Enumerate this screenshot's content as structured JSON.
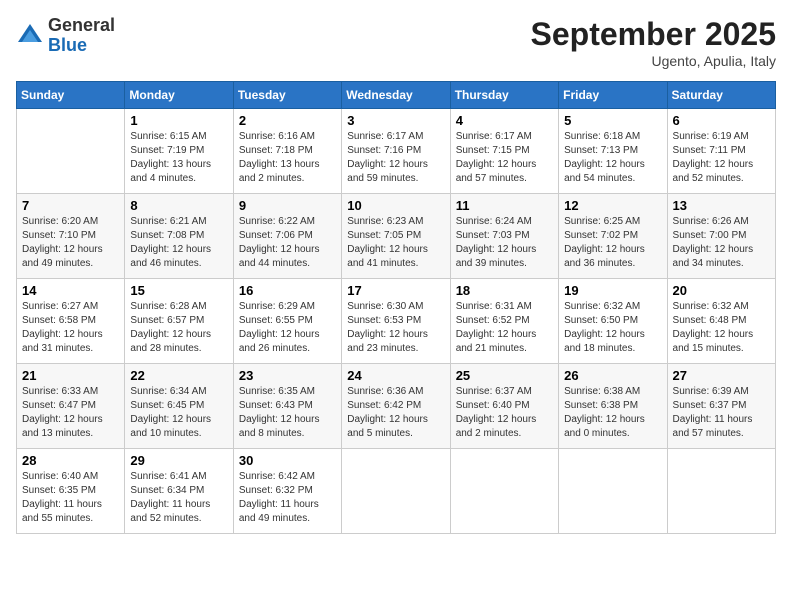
{
  "header": {
    "logo_general": "General",
    "logo_blue": "Blue",
    "month_title": "September 2025",
    "location": "Ugento, Apulia, Italy"
  },
  "days_of_week": [
    "Sunday",
    "Monday",
    "Tuesday",
    "Wednesday",
    "Thursday",
    "Friday",
    "Saturday"
  ],
  "weeks": [
    [
      {
        "day": "",
        "sunrise": "",
        "sunset": "",
        "daylight": ""
      },
      {
        "day": "1",
        "sunrise": "Sunrise: 6:15 AM",
        "sunset": "Sunset: 7:19 PM",
        "daylight": "Daylight: 13 hours and 4 minutes."
      },
      {
        "day": "2",
        "sunrise": "Sunrise: 6:16 AM",
        "sunset": "Sunset: 7:18 PM",
        "daylight": "Daylight: 13 hours and 2 minutes."
      },
      {
        "day": "3",
        "sunrise": "Sunrise: 6:17 AM",
        "sunset": "Sunset: 7:16 PM",
        "daylight": "Daylight: 12 hours and 59 minutes."
      },
      {
        "day": "4",
        "sunrise": "Sunrise: 6:17 AM",
        "sunset": "Sunset: 7:15 PM",
        "daylight": "Daylight: 12 hours and 57 minutes."
      },
      {
        "day": "5",
        "sunrise": "Sunrise: 6:18 AM",
        "sunset": "Sunset: 7:13 PM",
        "daylight": "Daylight: 12 hours and 54 minutes."
      },
      {
        "day": "6",
        "sunrise": "Sunrise: 6:19 AM",
        "sunset": "Sunset: 7:11 PM",
        "daylight": "Daylight: 12 hours and 52 minutes."
      }
    ],
    [
      {
        "day": "7",
        "sunrise": "Sunrise: 6:20 AM",
        "sunset": "Sunset: 7:10 PM",
        "daylight": "Daylight: 12 hours and 49 minutes."
      },
      {
        "day": "8",
        "sunrise": "Sunrise: 6:21 AM",
        "sunset": "Sunset: 7:08 PM",
        "daylight": "Daylight: 12 hours and 46 minutes."
      },
      {
        "day": "9",
        "sunrise": "Sunrise: 6:22 AM",
        "sunset": "Sunset: 7:06 PM",
        "daylight": "Daylight: 12 hours and 44 minutes."
      },
      {
        "day": "10",
        "sunrise": "Sunrise: 6:23 AM",
        "sunset": "Sunset: 7:05 PM",
        "daylight": "Daylight: 12 hours and 41 minutes."
      },
      {
        "day": "11",
        "sunrise": "Sunrise: 6:24 AM",
        "sunset": "Sunset: 7:03 PM",
        "daylight": "Daylight: 12 hours and 39 minutes."
      },
      {
        "day": "12",
        "sunrise": "Sunrise: 6:25 AM",
        "sunset": "Sunset: 7:02 PM",
        "daylight": "Daylight: 12 hours and 36 minutes."
      },
      {
        "day": "13",
        "sunrise": "Sunrise: 6:26 AM",
        "sunset": "Sunset: 7:00 PM",
        "daylight": "Daylight: 12 hours and 34 minutes."
      }
    ],
    [
      {
        "day": "14",
        "sunrise": "Sunrise: 6:27 AM",
        "sunset": "Sunset: 6:58 PM",
        "daylight": "Daylight: 12 hours and 31 minutes."
      },
      {
        "day": "15",
        "sunrise": "Sunrise: 6:28 AM",
        "sunset": "Sunset: 6:57 PM",
        "daylight": "Daylight: 12 hours and 28 minutes."
      },
      {
        "day": "16",
        "sunrise": "Sunrise: 6:29 AM",
        "sunset": "Sunset: 6:55 PM",
        "daylight": "Daylight: 12 hours and 26 minutes."
      },
      {
        "day": "17",
        "sunrise": "Sunrise: 6:30 AM",
        "sunset": "Sunset: 6:53 PM",
        "daylight": "Daylight: 12 hours and 23 minutes."
      },
      {
        "day": "18",
        "sunrise": "Sunrise: 6:31 AM",
        "sunset": "Sunset: 6:52 PM",
        "daylight": "Daylight: 12 hours and 21 minutes."
      },
      {
        "day": "19",
        "sunrise": "Sunrise: 6:32 AM",
        "sunset": "Sunset: 6:50 PM",
        "daylight": "Daylight: 12 hours and 18 minutes."
      },
      {
        "day": "20",
        "sunrise": "Sunrise: 6:32 AM",
        "sunset": "Sunset: 6:48 PM",
        "daylight": "Daylight: 12 hours and 15 minutes."
      }
    ],
    [
      {
        "day": "21",
        "sunrise": "Sunrise: 6:33 AM",
        "sunset": "Sunset: 6:47 PM",
        "daylight": "Daylight: 12 hours and 13 minutes."
      },
      {
        "day": "22",
        "sunrise": "Sunrise: 6:34 AM",
        "sunset": "Sunset: 6:45 PM",
        "daylight": "Daylight: 12 hours and 10 minutes."
      },
      {
        "day": "23",
        "sunrise": "Sunrise: 6:35 AM",
        "sunset": "Sunset: 6:43 PM",
        "daylight": "Daylight: 12 hours and 8 minutes."
      },
      {
        "day": "24",
        "sunrise": "Sunrise: 6:36 AM",
        "sunset": "Sunset: 6:42 PM",
        "daylight": "Daylight: 12 hours and 5 minutes."
      },
      {
        "day": "25",
        "sunrise": "Sunrise: 6:37 AM",
        "sunset": "Sunset: 6:40 PM",
        "daylight": "Daylight: 12 hours and 2 minutes."
      },
      {
        "day": "26",
        "sunrise": "Sunrise: 6:38 AM",
        "sunset": "Sunset: 6:38 PM",
        "daylight": "Daylight: 12 hours and 0 minutes."
      },
      {
        "day": "27",
        "sunrise": "Sunrise: 6:39 AM",
        "sunset": "Sunset: 6:37 PM",
        "daylight": "Daylight: 11 hours and 57 minutes."
      }
    ],
    [
      {
        "day": "28",
        "sunrise": "Sunrise: 6:40 AM",
        "sunset": "Sunset: 6:35 PM",
        "daylight": "Daylight: 11 hours and 55 minutes."
      },
      {
        "day": "29",
        "sunrise": "Sunrise: 6:41 AM",
        "sunset": "Sunset: 6:34 PM",
        "daylight": "Daylight: 11 hours and 52 minutes."
      },
      {
        "day": "30",
        "sunrise": "Sunrise: 6:42 AM",
        "sunset": "Sunset: 6:32 PM",
        "daylight": "Daylight: 11 hours and 49 minutes."
      },
      {
        "day": "",
        "sunrise": "",
        "sunset": "",
        "daylight": ""
      },
      {
        "day": "",
        "sunrise": "",
        "sunset": "",
        "daylight": ""
      },
      {
        "day": "",
        "sunrise": "",
        "sunset": "",
        "daylight": ""
      },
      {
        "day": "",
        "sunrise": "",
        "sunset": "",
        "daylight": ""
      }
    ]
  ]
}
